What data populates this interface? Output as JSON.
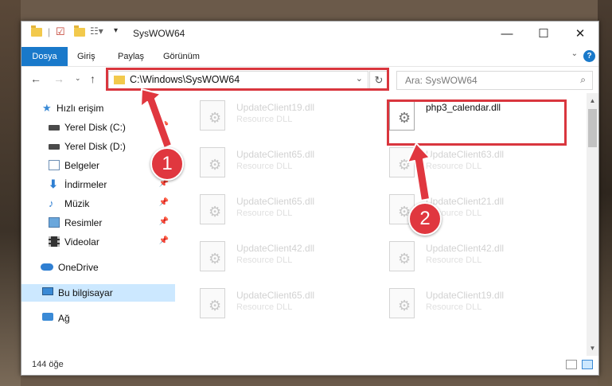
{
  "window": {
    "title": "SysWOW64"
  },
  "ribbon": {
    "tabs": [
      "Dosya",
      "Giriş",
      "Paylaş",
      "Görünüm"
    ]
  },
  "address": {
    "path": "C:\\Windows\\SysWOW64"
  },
  "search": {
    "placeholder": "Ara: SysWOW64"
  },
  "nav": {
    "quick_access": "Hızlı erişim",
    "items": [
      {
        "label": "Yerel Disk (C:)",
        "icon": "drive-icon",
        "pinned": true
      },
      {
        "label": "Yerel Disk (D:)",
        "icon": "drive-icon",
        "pinned": false
      },
      {
        "label": "Belgeler",
        "icon": "documents-icon",
        "pinned": true
      },
      {
        "label": "İndirmeler",
        "icon": "download-icon",
        "pinned": true
      },
      {
        "label": "Müzik",
        "icon": "music-icon",
        "pinned": true
      },
      {
        "label": "Resimler",
        "icon": "pictures-icon",
        "pinned": true
      },
      {
        "label": "Videolar",
        "icon": "video-icon",
        "pinned": true
      }
    ],
    "onedrive": "OneDrive",
    "this_pc": "Bu bilgisayar",
    "network": "Ağ"
  },
  "files": {
    "left": [
      {
        "name": "UpdateClient19.dll",
        "type": "Resource DLL"
      },
      {
        "name": "UpdateClient65.dll",
        "type": "Resource DLL"
      },
      {
        "name": "UpdateClient65.dll",
        "type": "Resource DLL"
      },
      {
        "name": "UpdateClient42.dll",
        "type": "Resource DLL"
      },
      {
        "name": "UpdateClient65.dll",
        "type": "Resource DLL"
      }
    ],
    "right": [
      {
        "name": "php3_calendar.dll",
        "type": ""
      },
      {
        "name": "UpdateClient63.dll",
        "type": "Resource DLL"
      },
      {
        "name": "UpdateClient21.dll",
        "type": "Resource DLL"
      },
      {
        "name": "UpdateClient42.dll",
        "type": "Resource DLL"
      },
      {
        "name": "UpdateClient19.dll",
        "type": "Resource DLL"
      }
    ]
  },
  "status": {
    "count": "144 öğe"
  },
  "callouts": {
    "one": "1",
    "two": "2"
  },
  "colors": {
    "accent": "#1979ca",
    "highlight": "#d9363e",
    "selected": "#cce8ff"
  }
}
